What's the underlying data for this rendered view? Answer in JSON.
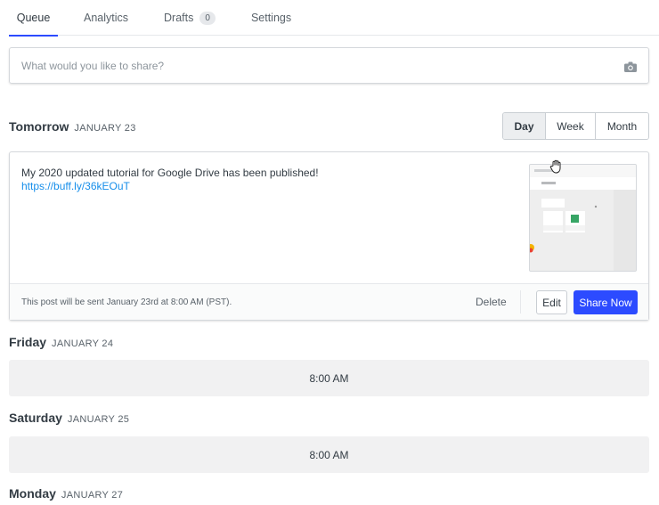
{
  "tabs": [
    {
      "label": "Queue",
      "active": true
    },
    {
      "label": "Analytics"
    },
    {
      "label": "Drafts",
      "badge": "0"
    },
    {
      "label": "Settings"
    }
  ],
  "composer": {
    "placeholder": "What would you like to share?",
    "icon": "camera-icon"
  },
  "view_toggle": {
    "options": [
      "Day",
      "Week",
      "Month"
    ],
    "selected": "Day"
  },
  "days": [
    {
      "name": "Tomorrow",
      "date": "JANUARY 23"
    },
    {
      "name": "Friday",
      "date": "JANUARY 24"
    },
    {
      "name": "Saturday",
      "date": "JANUARY 25"
    },
    {
      "name": "Monday",
      "date": "JANUARY 27"
    }
  ],
  "post": {
    "text": "My 2020 updated tutorial for Google Drive has been published!",
    "link": "https://buff.ly/36kEOuT",
    "status": "This post will be sent January 23rd at 8:00 AM (PST).",
    "delete_label": "Delete",
    "edit_label": "Edit",
    "share_label": "Share Now"
  },
  "slots": [
    {
      "time": "8:00 AM"
    },
    {
      "time": "8:00 AM"
    }
  ],
  "colors": {
    "accent": "#2c4bff",
    "link": "#168eea",
    "slot_bg": "#f1f1f2"
  }
}
